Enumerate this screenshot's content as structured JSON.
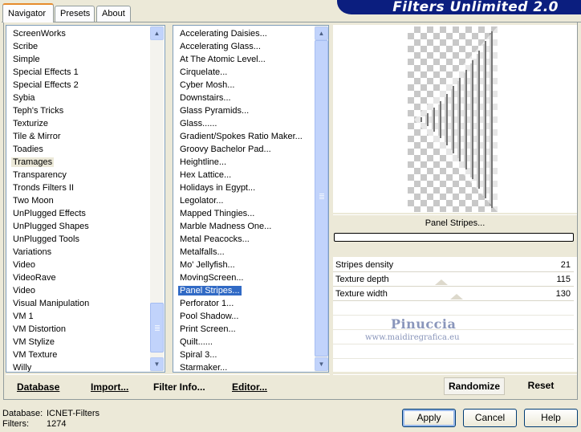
{
  "tabs": [
    "Navigator",
    "Presets",
    "About"
  ],
  "brand": "Filters Unlimited 2.0",
  "categories": [
    "ScreenWorks",
    "Scribe",
    "Simple",
    "Special Effects 1",
    "Special Effects 2",
    "Sybia",
    "Teph's Tricks",
    "Texturize",
    "Tile & Mirror",
    "Toadies",
    "Tramages",
    "Transparency",
    "Tronds Filters II",
    "Two Moon",
    "UnPlugged Effects",
    "UnPlugged Shapes",
    "UnPlugged Tools",
    "Variations",
    "Video",
    "VideoRave",
    "Video",
    "Visual Manipulation",
    "VM 1",
    "VM Distortion",
    "VM Stylize",
    "VM Texture",
    "Willy"
  ],
  "selected_category": "Tramages",
  "filters": [
    "Accelerating Daisies...",
    "Accelerating Glass...",
    "At The Atomic Level...",
    "Cirquelate...",
    "Cyber Mosh...",
    "Downstairs...",
    "Glass Pyramids...",
    "Glass......",
    "Gradient/Spokes Ratio Maker...",
    "Groovy Bachelor Pad...",
    "Heightline...",
    "Hex Lattice...",
    "Holidays in Egypt...",
    "Legolator...",
    "Mapped Thingies...",
    "Marble Madness One...",
    "Metal Peacocks...",
    "Metalfalls...",
    "Mo' Jellyfish...",
    "MovingScreen...",
    "Panel Stripes...",
    "Perforator 1...",
    "Pool Shadow...",
    "Print Screen...",
    "Quilt......",
    "Spiral 3...",
    "Starmaker..."
  ],
  "selected_filter": "Panel Stripes...",
  "preview": {
    "filter_name": "Panel Stripes..."
  },
  "parameters": [
    {
      "label": "Stripes density",
      "value": "21"
    },
    {
      "label": "Texture depth",
      "value": "115"
    },
    {
      "label": "Texture width",
      "value": "130"
    }
  ],
  "watermark": {
    "name": "Pinuccia",
    "url": "www.maidiregrafica.eu"
  },
  "left_buttons": {
    "database": "Database",
    "import": "Import...",
    "filter_info": "Filter Info...",
    "editor": "Editor..."
  },
  "right_buttons": {
    "randomize": "Randomize",
    "reset": "Reset"
  },
  "status": {
    "database_label": "Database:",
    "database_value": "ICNET-Filters",
    "filters_label": "Filters:",
    "filters_value": "1274"
  },
  "dialog_buttons": {
    "apply": "Apply",
    "cancel": "Cancel",
    "help": "Help"
  }
}
